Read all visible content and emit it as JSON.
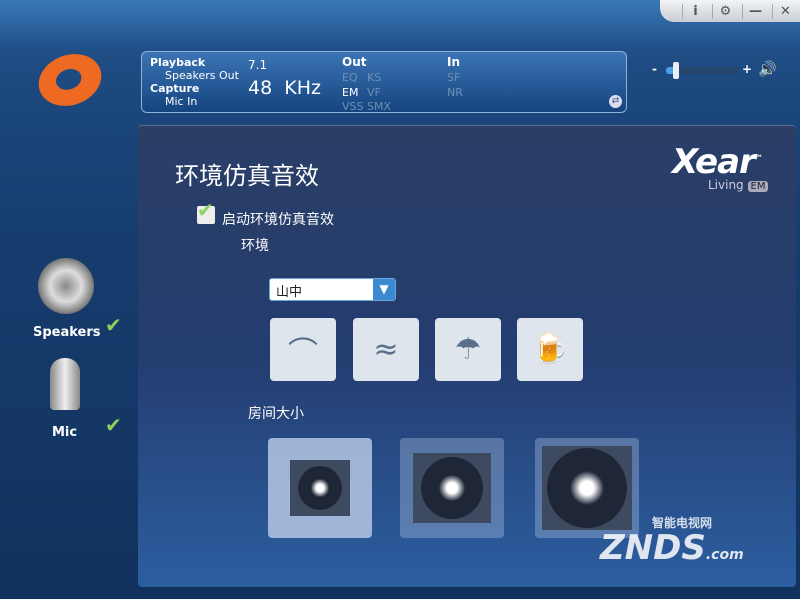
{
  "window_controls": {
    "info": "i",
    "settings": "⚙",
    "minimize": "—",
    "close": "✕"
  },
  "status": {
    "playback_label": "Playback",
    "playback_device": "Speakers Out",
    "capture_label": "Capture",
    "capture_device": "Mic In",
    "channels": "7.1",
    "sample_rate": "48  KHz",
    "out_label": "Out",
    "out_effects": [
      "EQ",
      "KS",
      "EM",
      "VF",
      "VSS",
      "SMX"
    ],
    "out_active": [
      "EM"
    ],
    "in_label": "In",
    "in_effects": [
      "SF",
      "NR"
    ]
  },
  "volume": {
    "minus": "-",
    "plus": "+",
    "level_percent": 12
  },
  "sidebar": {
    "items": [
      {
        "label": "Speakers",
        "checked": true
      },
      {
        "label": "Mic",
        "checked": true
      }
    ]
  },
  "brand": {
    "name": "Xear",
    "tm": "™",
    "sub": "Living",
    "badge": "EM"
  },
  "main": {
    "title": "环境仿真音效",
    "enable_label": "启动环境仿真音效",
    "enable_checked": true,
    "environment_label": "环境",
    "environment_value": "山中",
    "presets": [
      {
        "icon": "opera-house-icon",
        "glyph": "⌒"
      },
      {
        "icon": "water-icon",
        "glyph": "≈"
      },
      {
        "icon": "shower-icon",
        "glyph": "☂"
      },
      {
        "icon": "beer-mug-icon",
        "glyph": "🍺"
      }
    ],
    "room_size_label": "房间大小",
    "room_sizes": [
      {
        "name": "small",
        "selected": true
      },
      {
        "name": "medium",
        "selected": false
      },
      {
        "name": "large",
        "selected": false
      }
    ]
  },
  "watermark": {
    "text": "ZNDS",
    "suffix": ".com",
    "cn": "智能电视网"
  },
  "colors": {
    "accent": "#3b8ad0",
    "logo": "#ee6a22",
    "check": "#8fd35a"
  }
}
